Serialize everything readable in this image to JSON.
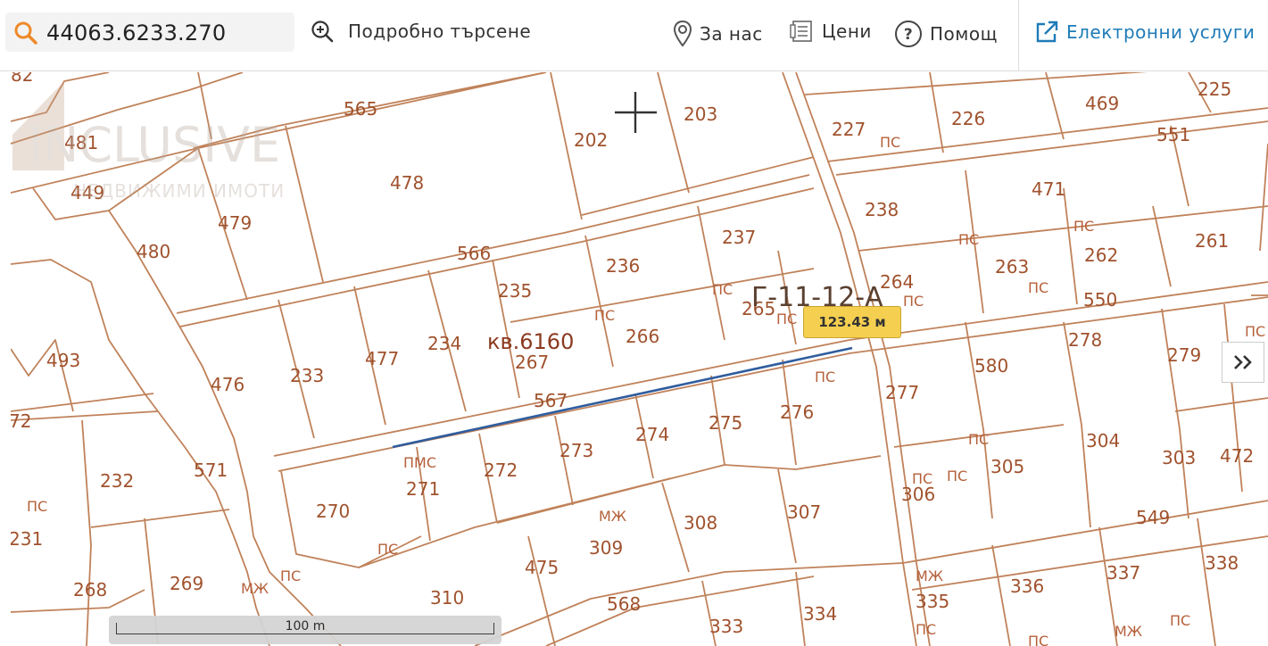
{
  "search": {
    "value": "44063.6233.270"
  },
  "nav": {
    "advanced_search": "Подробно търсене",
    "about": "За нас",
    "prices": "Цени",
    "help": "Помощ",
    "e_services": "Електронни услуги"
  },
  "map": {
    "measurement": "123.43 м",
    "scale": "100 m",
    "block_label": "кв.6160",
    "zone_label": "Г-11-12-А",
    "watermark_brand": "INCLUSIVE",
    "watermark_sub": "НЕДВИЖИМИ ИМОТИ",
    "parcels": [
      "82",
      "565",
      "481",
      "449",
      "478",
      "202",
      "203",
      "227",
      "226",
      "469",
      "225",
      "551",
      "479",
      "480",
      "566",
      "238",
      "471",
      "237",
      "236",
      "235",
      "264",
      "263",
      "262",
      "261",
      "550",
      "265",
      "266",
      "234",
      "477",
      "233",
      "476",
      "493",
      "267",
      "278",
      "279",
      "580",
      "277",
      "567",
      "276",
      "275",
      "274",
      "273",
      "304",
      "303",
      "472",
      "305",
      "306",
      "232",
      "571",
      "272",
      "271",
      "270",
      "231",
      "72",
      "309",
      "308",
      "307",
      "549",
      "475",
      "268",
      "269",
      "310",
      "568",
      "333",
      "334",
      "335",
      "336",
      "337",
      "338"
    ],
    "markers": {
      "ps": "ПС",
      "mzh": "МЖ",
      "pms": "ПМС"
    },
    "colors": {
      "parcel_line": "#c0825a",
      "label": "#a0522d",
      "measure_line": "#2f5d9e",
      "tag": "#f5cf4f",
      "accent": "#1e7bb8",
      "search_icon": "#ee8a2a"
    }
  }
}
